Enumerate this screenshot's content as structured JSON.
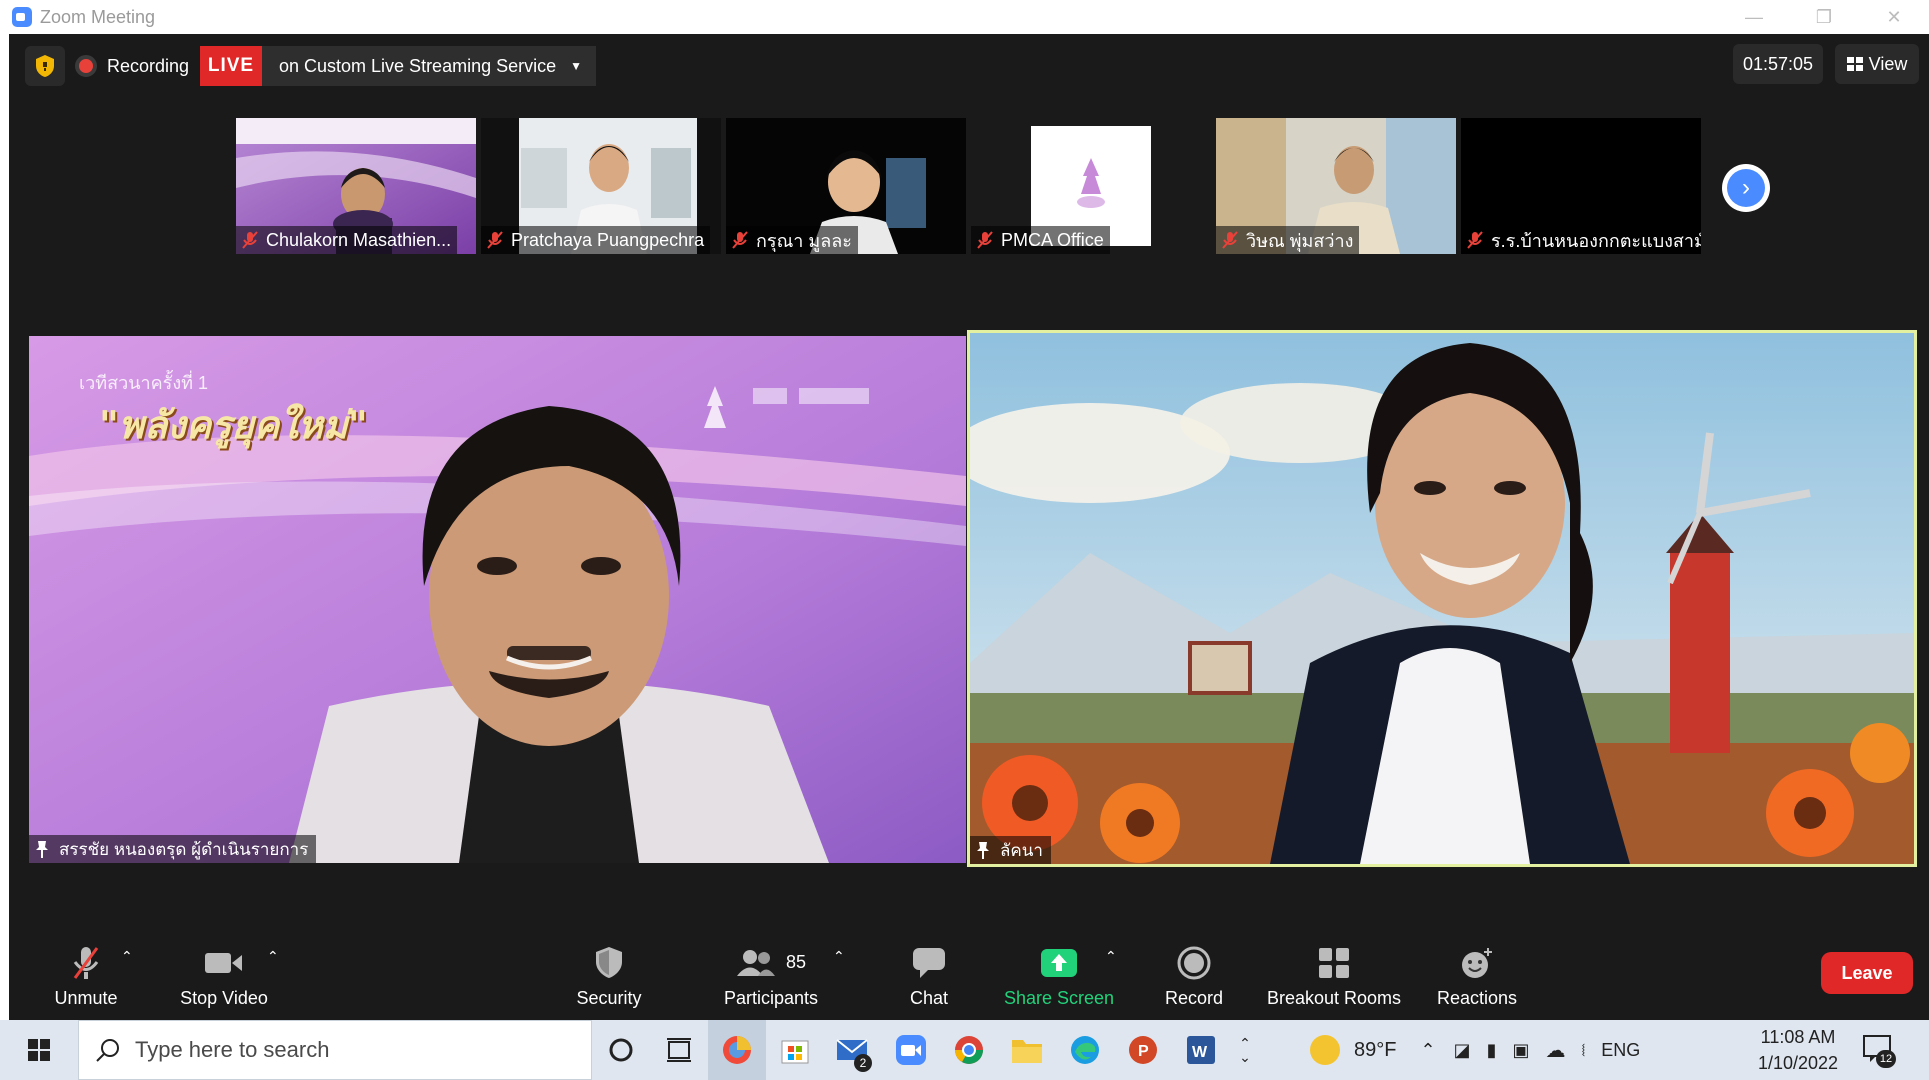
{
  "window": {
    "title": "Zoom Meeting"
  },
  "topbar": {
    "recording_label": "Recording",
    "live_badge": "LIVE",
    "live_service": "on Custom Live Streaming Service",
    "timer": "01:57:05",
    "view_label": "View"
  },
  "thumbnails": [
    {
      "name": "Chulakorn Masathien..."
    },
    {
      "name": "Pratchaya Puangpechra"
    },
    {
      "name": "กรุณา มูลละ"
    },
    {
      "name": "PMCA Office"
    },
    {
      "name": "วิษณ พุ่มสว่าง"
    },
    {
      "name": "ร.ร.บ้านหนองกกตะแบงสามั..."
    }
  ],
  "main_tiles": {
    "left": {
      "name": "สรรชัย หนองตรุด ผู้ดำเนินรายการ",
      "banner_small": "เวทีสวนาครั้งที่ 1",
      "banner_title": "\"พลังครูยุคใหม่\""
    },
    "right": {
      "name": "ลัคนา"
    }
  },
  "toolbar": {
    "unmute": "Unmute",
    "stop_video": "Stop Video",
    "security": "Security",
    "participants": "Participants",
    "participants_count": "85",
    "chat": "Chat",
    "share_screen": "Share Screen",
    "record": "Record",
    "breakout_rooms": "Breakout Rooms",
    "reactions": "Reactions",
    "leave": "Leave"
  },
  "taskbar": {
    "search_placeholder": "Type here to search",
    "mail_badge": "2",
    "weather": "89°F",
    "language": "ENG",
    "time": "11:08 AM",
    "date": "1/10/2022",
    "notification_count": "12"
  },
  "colors": {
    "zoom_blue": "#4a8cff",
    "live_red": "#e02828",
    "share_green": "#22d27a",
    "active_speaker_border": "#e3f0a0"
  }
}
